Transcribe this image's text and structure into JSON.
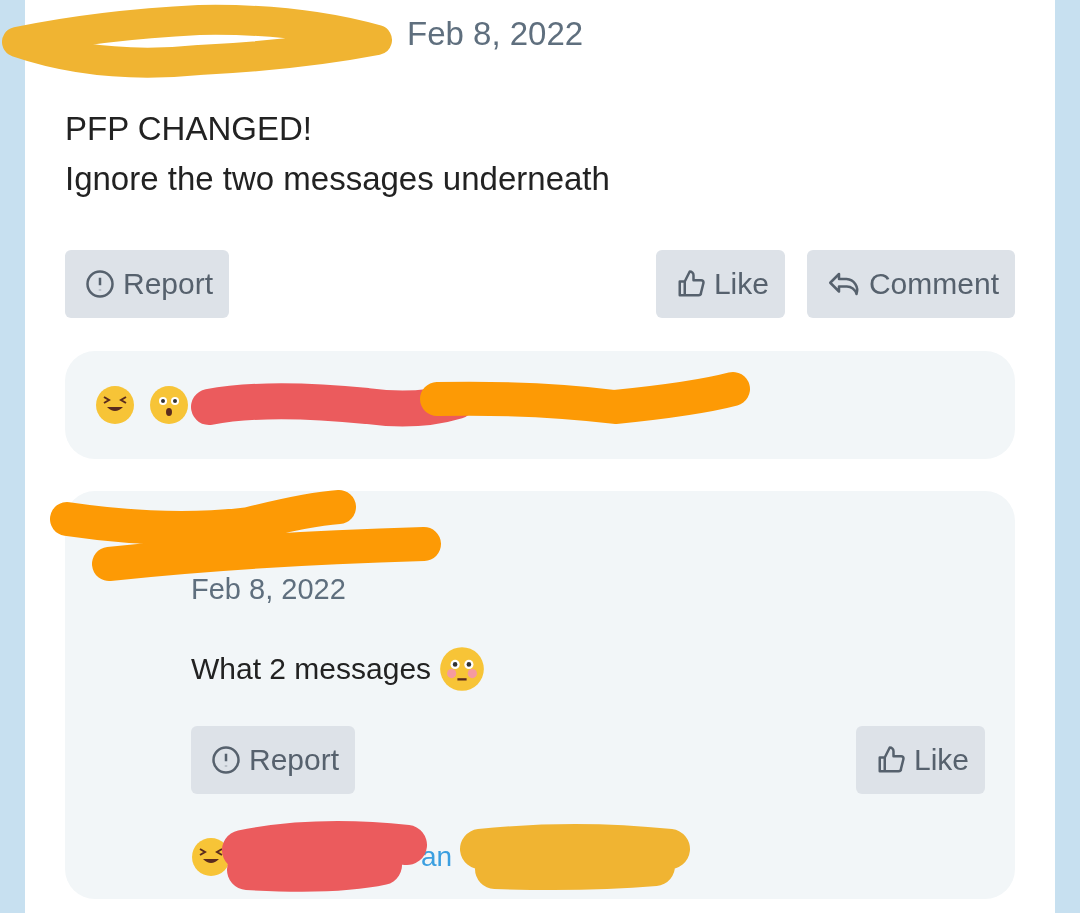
{
  "post": {
    "author_redaction": {
      "color": "#f0b432"
    },
    "date": "Feb 8, 2022",
    "lines": [
      "PFP CHANGED!",
      "Ignore the two messages underneath"
    ],
    "actions": [
      {
        "kind": "report",
        "label": "Report"
      },
      {
        "kind": "like",
        "label": "Like"
      },
      {
        "kind": "comment",
        "label": "Comment"
      }
    ],
    "reactions": {
      "emojis": [
        {
          "kind": "laughing"
        },
        {
          "kind": "shocked"
        }
      ],
      "redactions": [
        {
          "color": "#eb5b5d"
        },
        {
          "color": "#fd9a05"
        }
      ]
    }
  },
  "comment": {
    "author_redaction": {
      "color": "#fd9a05"
    },
    "date": "Feb 8, 2022",
    "text": "What 2 messages",
    "emoji": {
      "kind": "flushed"
    },
    "actions": [
      {
        "kind": "report",
        "label": "Report"
      },
      {
        "kind": "like",
        "label": "Like"
      }
    ],
    "reactions": {
      "emojis": [
        {
          "kind": "laughing"
        }
      ],
      "joiner": "an",
      "redactions": [
        {
          "color": "#eb5b5d"
        },
        {
          "color": "#f0b432"
        }
      ]
    }
  }
}
